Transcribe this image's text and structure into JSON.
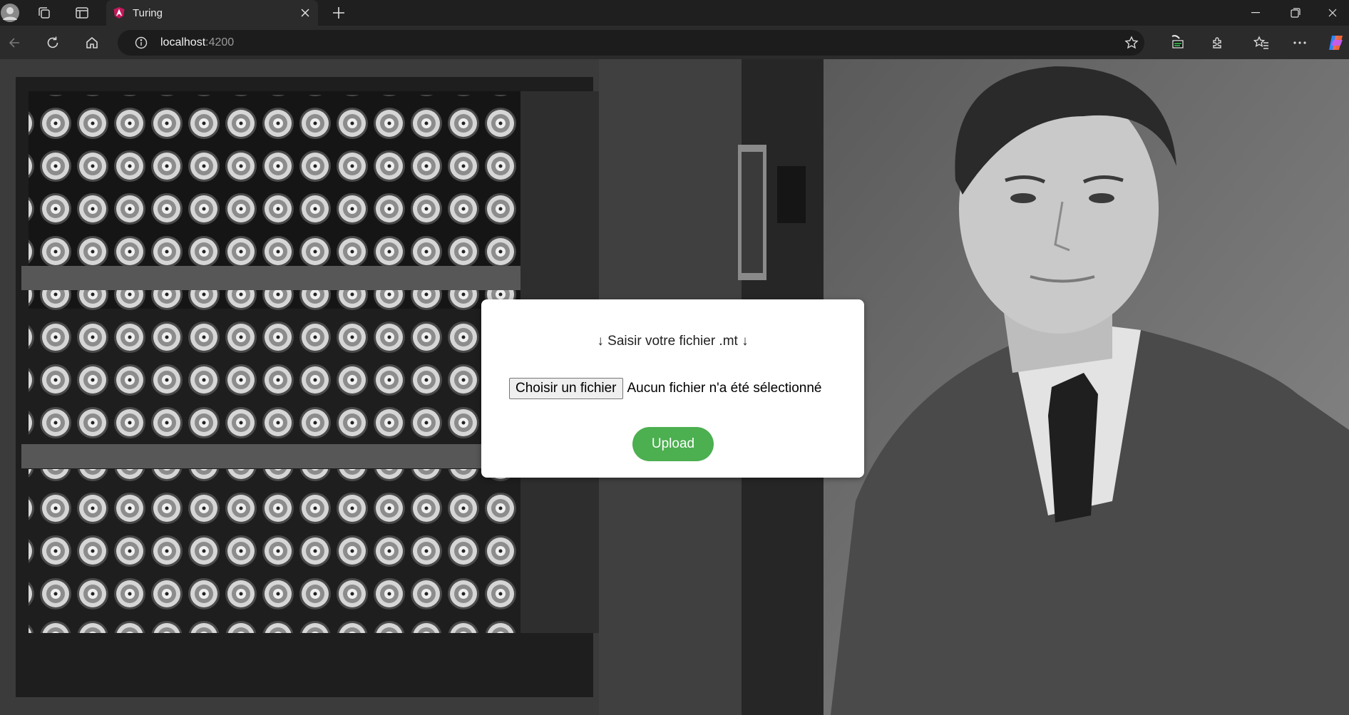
{
  "browser": {
    "tab": {
      "title": "Turing"
    },
    "address": {
      "host": "localhost",
      "port": ":4200"
    },
    "colors": {
      "titlebar": "#1f1f1f",
      "toolbar": "#2b2b2b",
      "tab_active": "#2b2b2b"
    },
    "icons": [
      "profile-icon",
      "collections-icon",
      "tab-actions-icon",
      "angular-favicon",
      "close-icon",
      "new-tab-icon",
      "minimize-icon",
      "restore-icon",
      "window-close-icon",
      "back-icon",
      "refresh-icon",
      "home-icon",
      "info-icon",
      "favorite-star-icon",
      "extension-feature-icon",
      "extensions-icon",
      "favorites-icon",
      "more-icon",
      "copilot-icon"
    ]
  },
  "page": {
    "card": {
      "title": "↓ Saisir votre fichier .mt ↓",
      "file_button": "Choisir un fichier",
      "file_status": "Aucun fichier n'a été sélectionné",
      "upload_label": "Upload"
    },
    "colors": {
      "upload_button": "#4caf50",
      "card_bg": "#ffffff"
    }
  }
}
